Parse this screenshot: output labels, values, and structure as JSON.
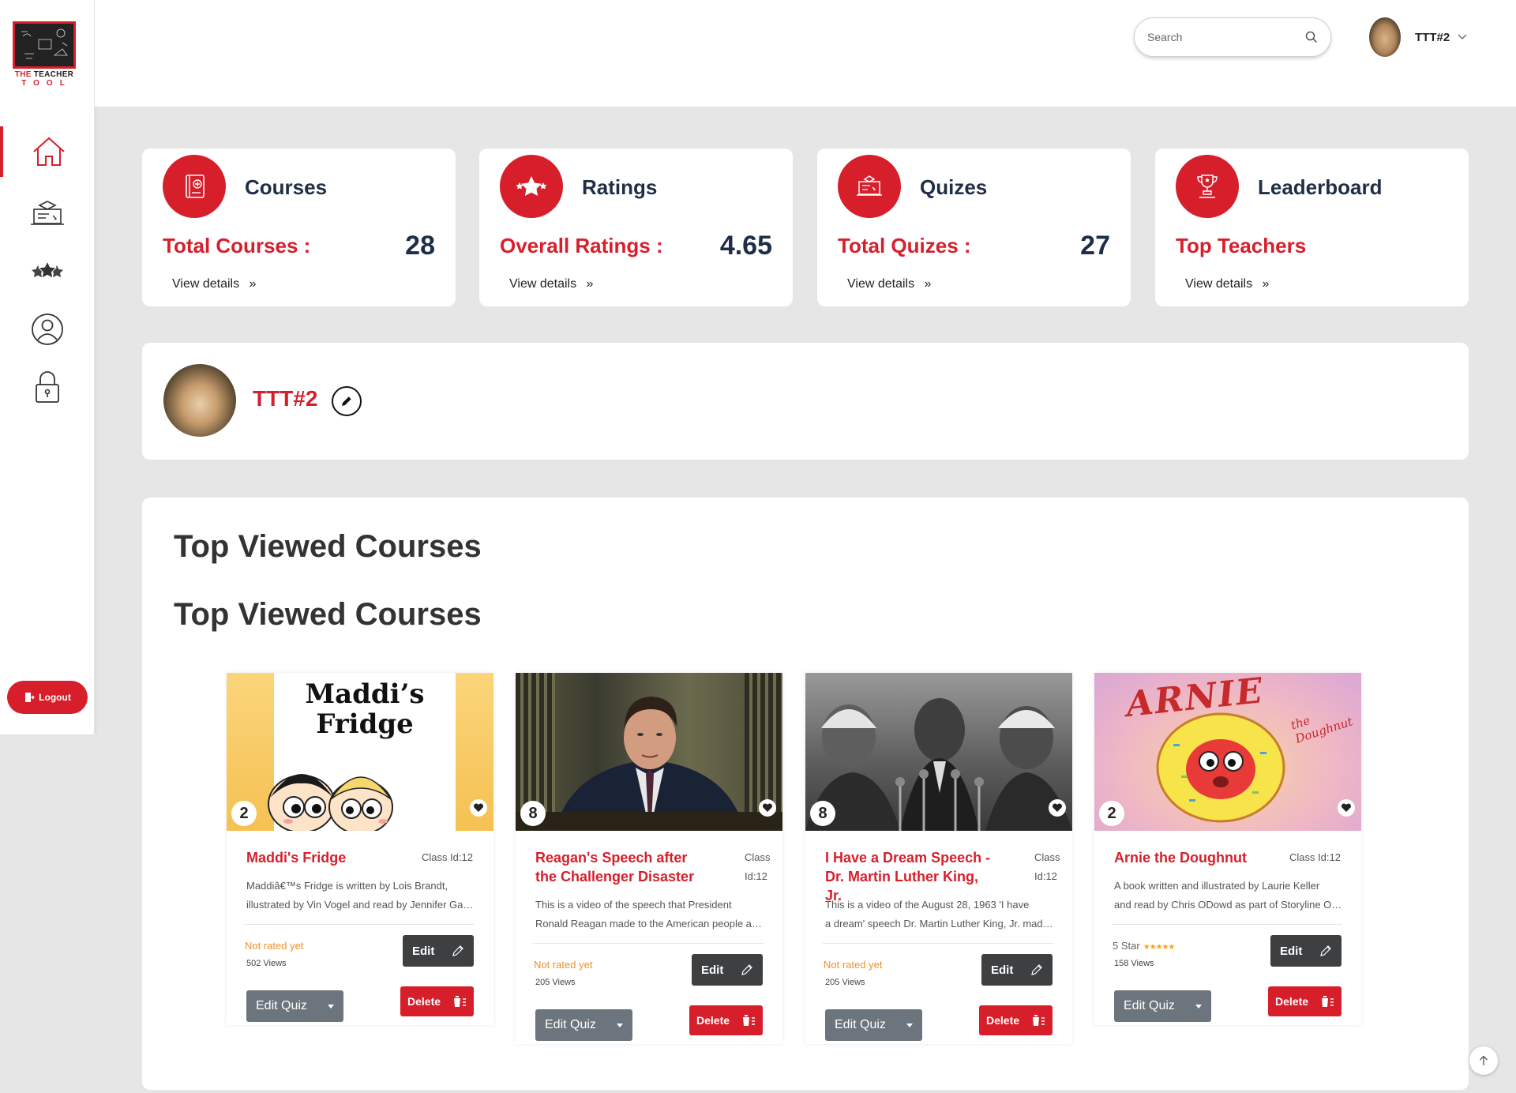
{
  "brand": {
    "line1_a": "THE",
    "line1_b": " TEACHER",
    "line2": "TOOL",
    "board_text": ""
  },
  "colors": {
    "accent": "#d71f2b",
    "navy": "#1f2e46",
    "dark_button": "#3d3f41",
    "quiz_button": "#6c757d",
    "background": "#e6e6e6"
  },
  "sidebar": {
    "items": [
      {
        "icon": "home-icon",
        "active": true
      },
      {
        "icon": "courses-icon",
        "active": false
      },
      {
        "icon": "star-rating-icon",
        "active": false
      },
      {
        "icon": "user-profile-icon",
        "active": false
      },
      {
        "icon": "lock-icon",
        "active": false
      }
    ],
    "logout_label": "Logout"
  },
  "header": {
    "search_placeholder": "Search",
    "user_name": "TTT#2"
  },
  "stats": [
    {
      "title": "Courses",
      "label": "Total Courses :",
      "value": "28",
      "link": "View details",
      "icon": "course-book-icon"
    },
    {
      "title": "Ratings",
      "label": "Overall Ratings :",
      "value": "4.65",
      "link": "View details",
      "icon": "rating-star-icon"
    },
    {
      "title": "Quizes",
      "label": "Total Quizes :",
      "value": "27",
      "link": "View details",
      "icon": "quiz-icon"
    },
    {
      "title": "Leaderboard",
      "label": "Top Teachers",
      "value": "",
      "link": "View details",
      "icon": "trophy-icon"
    }
  ],
  "profile": {
    "name": "TTT#2"
  },
  "section": {
    "title_1": "Top Viewed Courses",
    "title_2": "Top Viewed Courses"
  },
  "courses": [
    {
      "title": "Maddi's Fridge",
      "class_id": "Class Id:12",
      "desc_line1": "Maddiâ€™s Fridge is written by Lois Brandt,",
      "desc_line2": "illustrated by Vin Vogel and read by Jennifer Garner as part of Storyline Online.",
      "rating": "Not rated yet",
      "views": "502 Views",
      "badge": "2",
      "thumb_text_1": "Maddi’s",
      "thumb_text_2": "Fridge",
      "edit_label": "Edit",
      "edit_quiz_label": "Edit Quiz",
      "delete_label": "Delete"
    },
    {
      "title": "Reagan's Speech after the Challenger Disaster",
      "class_id_1": "Class",
      "class_id_2": "Id:12",
      "desc_line1": "This is a video of the speech that President",
      "desc_line2": "Ronald Reagan made to the American people after the Challenger disaster.",
      "rating": "Not rated yet",
      "views": "205 Views",
      "badge": "8",
      "edit_label": "Edit",
      "edit_quiz_label": "Edit Quiz",
      "delete_label": "Delete"
    },
    {
      "title": "I Have a Dream Speech - Dr. Martin Luther King, Jr.",
      "class_id_1": "Class",
      "class_id_2": "Id:12",
      "desc_line1": "This is a video of the August 28, 1963 'I have",
      "desc_line2": "a dream' speech Dr. Martin Luther King, Jr. made in Washington D.C.",
      "rating": "Not rated yet",
      "views": "205 Views",
      "badge": "8",
      "edit_label": "Edit",
      "edit_quiz_label": "Edit Quiz",
      "delete_label": "Delete"
    },
    {
      "title": "Arnie the Doughnut",
      "class_id": "Class Id:12",
      "desc_line1": "A book written and illustrated by Laurie Keller",
      "desc_line2": "and read by Chris ODowd as part of Storyline Online.",
      "rating": "5 Star",
      "stars": "★★★★★",
      "views": "158 Views",
      "badge": "2",
      "thumb_text_1": "ARNIE",
      "thumb_text_2": "the Doughnut",
      "edit_label": "Edit",
      "edit_quiz_label": "Edit Quiz",
      "delete_label": "Delete"
    }
  ]
}
